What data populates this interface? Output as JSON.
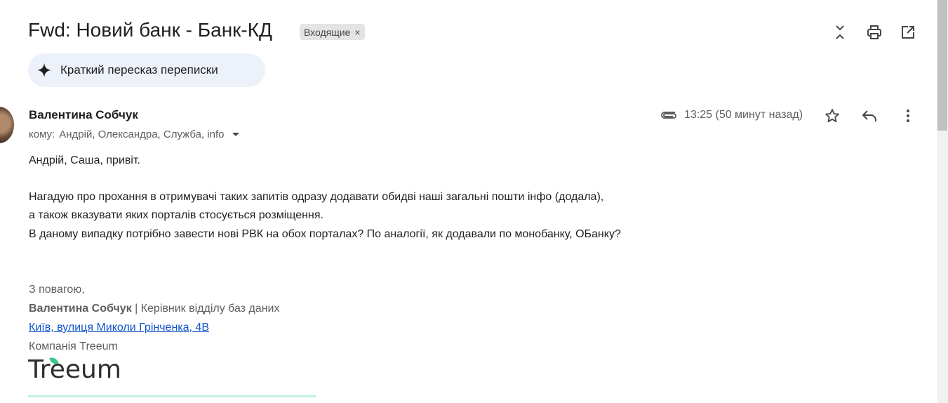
{
  "thread": {
    "subject": "Fwd: Новий банк - Банк-КД",
    "label": "Входящие",
    "label_remove": "×",
    "summary_button": "Краткий пересказ переписки"
  },
  "message": {
    "sender": "Валентина Собчук",
    "recipients_prefix": "кому:",
    "recipients": "Андрій, Олександра, Служба, info",
    "time": "13:25 (50 минут назад)",
    "has_attachment": true
  },
  "body": {
    "greeting": "Андрій, Саша, привіт.",
    "line1": "Нагадую про прохання в отримувачі таких запитів одразу додавати обидві наші загальні пошти інфо (додала),",
    "line2": "а також вказувати яких порталів стосується розміщення.",
    "line3": "В даному випадку потрібно завести нові РВК на обох порталах? По аналогії, як додавали по монобанку, ОБанку?"
  },
  "signature": {
    "closing": "З повагою,",
    "name": "Валентина Собчук",
    "title": " | Керівник відділу баз даних",
    "address": "Київ, вулиця Миколи Грінченка, 4В",
    "company": "Компанія Treeum",
    "logo_text": "Treeum"
  },
  "colors": {
    "link": "#1155cc",
    "chip_bg": "#e4e4e4",
    "summary_bg": "#edf2fa",
    "logo_accent": "#3cc68a"
  },
  "icons": [
    "collapse-icon",
    "print-icon",
    "open-new-window-icon",
    "sparkle-icon",
    "attachment-icon",
    "star-icon",
    "reply-icon",
    "more-vert-icon",
    "chevron-down-icon"
  ]
}
